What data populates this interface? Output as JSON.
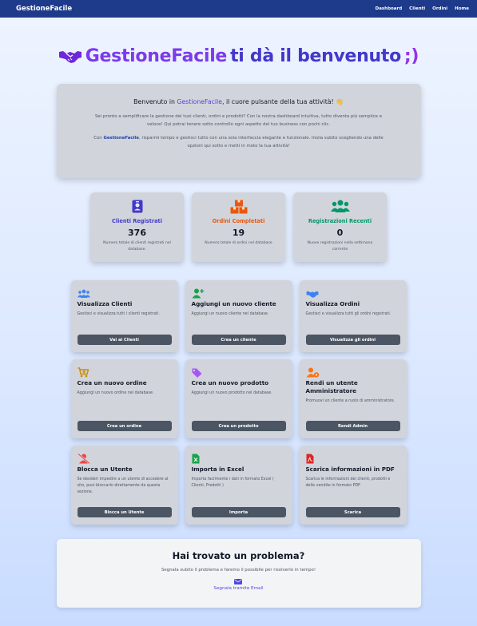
{
  "navbar": {
    "brand": "GestioneFacile",
    "links": [
      "Dashboard",
      "Clienti",
      "Ordini",
      "Home"
    ]
  },
  "hero": {
    "brand": "GestioneFacile",
    "rest": "ti dà il benvenuto",
    "smile": ";)"
  },
  "welcome": {
    "lead_pre": "Benvenuto in ",
    "lead_brand": "GestioneFacile",
    "lead_post": ", il cuore pulsante della tua attività! 👋",
    "para1": "Sei pronto a semplificare la gestione dei tuoi clienti, ordini e prodotti? Con la nostra dashboard intuitiva, tutto diventa più semplice e veloce! Qui potrai tenere sotto controllo ogni aspetto del tuo business con pochi clic.",
    "para2_pre": "Con ",
    "para2_brand": "GestioneFacile",
    "para2_post": ", risparmi tempo e gestisci tutto con una sola interfaccia elegante e funzionale. Inizia subito scegliendo una delle opzioni qui sotto e metti in moto la tua attività!"
  },
  "stats": [
    {
      "icon": "id-badge-icon",
      "color": "#4338ca",
      "title": "Clienti Registrati",
      "value": "376",
      "desc": "Numero totale di clienti registrati nel database."
    },
    {
      "icon": "boxes-icon",
      "color": "#ea580c",
      "title": "Ordini Completati",
      "value": "19",
      "desc": "Numero totale di ordini nel database"
    },
    {
      "icon": "users-icon",
      "color": "#059669",
      "title": "Registrazioni Recenti",
      "value": "0",
      "desc": "Nuove registrazioni nella settimana corrente"
    }
  ],
  "cards": [
    {
      "icon": "users-icon",
      "color": "#3b82f6",
      "title": "Visualizza Clienti",
      "desc": "Gestisci e visualizza tutti i clienti registrati.",
      "button": "Vai ai Clienti"
    },
    {
      "icon": "user-plus-icon",
      "color": "#16a34a",
      "title": "Aggiungi un nuovo cliente",
      "desc": "Aggiungi un nuovo cliente nel database.",
      "button": "Crea un cliente"
    },
    {
      "icon": "handshake-icon",
      "color": "#3b82f6",
      "title": "Visualizza Ordini",
      "desc": "Gestisci e visualizza tutti gli ordini registrati.",
      "button": "Visualizza gli ordini"
    },
    {
      "icon": "cart-plus-icon",
      "color": "#ca8a04",
      "title": "Crea un nuovo ordine",
      "desc": "Aggiungi un nuovo ordine nel database.",
      "button": "Crea un ordine"
    },
    {
      "icon": "tag-icon",
      "color": "#a855f7",
      "title": "Crea un nuovo prodotto",
      "desc": "Aggiungi un nuovo prodotto nel database.",
      "button": "Crea un prodotto"
    },
    {
      "icon": "user-gear-icon",
      "color": "#f97316",
      "title": "Rendi un utente Amministratore",
      "desc": "Promuovi un cliente a ruolo di amministratore.",
      "button": "Rendi Admin"
    },
    {
      "icon": "user-slash-icon",
      "color": "#ef4444",
      "title": "Blocca un Utente",
      "desc": "Se desideri impedire a un utente di accedere al sito, puoi bloccarlo direttamente da questa sezione.",
      "button": "Blocca un Utente"
    },
    {
      "icon": "file-excel-icon",
      "color": "#16a34a",
      "title": "Importa in Excel",
      "desc": "Importa facilmente i dati in formato Excel ( Clienti, Prodotti )",
      "button": "Importa"
    },
    {
      "icon": "file-pdf-icon",
      "color": "#dc2626",
      "title": "Scarica informazioni in PDF",
      "desc": "Scarica le informazioni dei clienti, prodotti e delle vendite in formato PDF.",
      "button": "Scarica"
    }
  ],
  "problem": {
    "title": "Hai trovato un problema?",
    "desc": "Segnala subito il problema e faremo il possibile per risolverlo in tempo!",
    "link": "Segnala tramite Email",
    "link_color": "#4f46e5"
  }
}
